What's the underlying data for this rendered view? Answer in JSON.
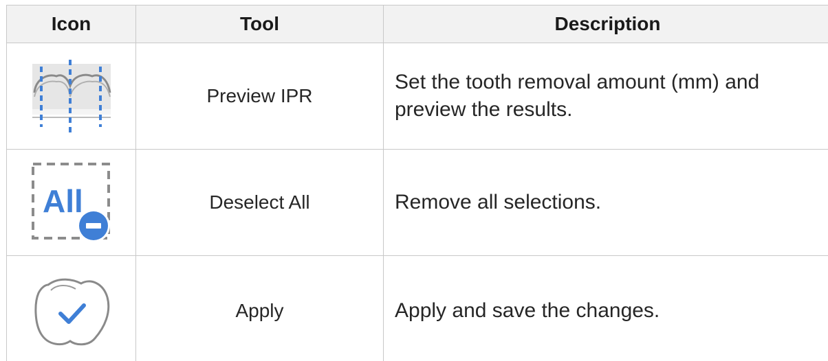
{
  "header": {
    "icon": "Icon",
    "tool": "Tool",
    "description": "Description"
  },
  "rows": [
    {
      "icon_name": "preview-ipr-icon",
      "tool": "Preview IPR",
      "description": "Set the tooth removal amount (mm) and preview the results."
    },
    {
      "icon_name": "deselect-all-icon",
      "icon_text": "All",
      "tool": "Deselect All",
      "description": "Remove all selections."
    },
    {
      "icon_name": "apply-tooth-check-icon",
      "tool": "Apply",
      "description": "Apply and save the changes."
    }
  ],
  "colors": {
    "accent_blue": "#3f7fd6",
    "border": "#c8c8c8",
    "header_bg": "#f2f2f2",
    "icon_gray": "#888888"
  }
}
